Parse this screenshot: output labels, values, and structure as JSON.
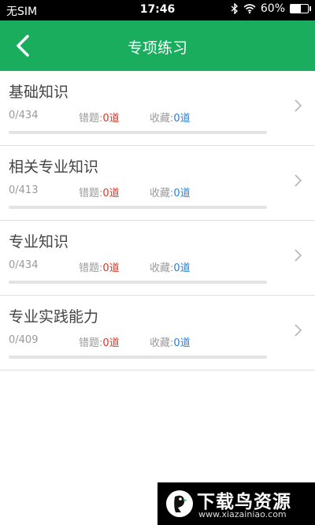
{
  "status_bar": {
    "carrier": "无SIM",
    "time": "17:46",
    "battery_percent": "60%",
    "battery_level": 0.6
  },
  "header": {
    "title": "专项练习",
    "back_icon": "chevron-left-icon"
  },
  "list": {
    "wrong_label": "错题:",
    "fav_label": "收藏:",
    "items": [
      {
        "title": "基础知识",
        "progress_text": "0/434",
        "progress_fraction": 0,
        "wrong": "0道",
        "favorites": "0道"
      },
      {
        "title": "相关专业知识",
        "progress_text": "0/413",
        "progress_fraction": 0,
        "wrong": "0道",
        "favorites": "0道"
      },
      {
        "title": "专业知识",
        "progress_text": "0/434",
        "progress_fraction": 0,
        "wrong": "0道",
        "favorites": "0道"
      },
      {
        "title": "专业实践能力",
        "progress_text": "0/409",
        "progress_fraction": 0,
        "wrong": "0道",
        "favorites": "0道"
      }
    ]
  },
  "watermark": {
    "name": "下载鸟资源",
    "url": "www.xiazainiao.com"
  },
  "colors": {
    "accent": "#1aad5e",
    "wrong": "#d23a2a",
    "favorite": "#2a7fd4"
  }
}
